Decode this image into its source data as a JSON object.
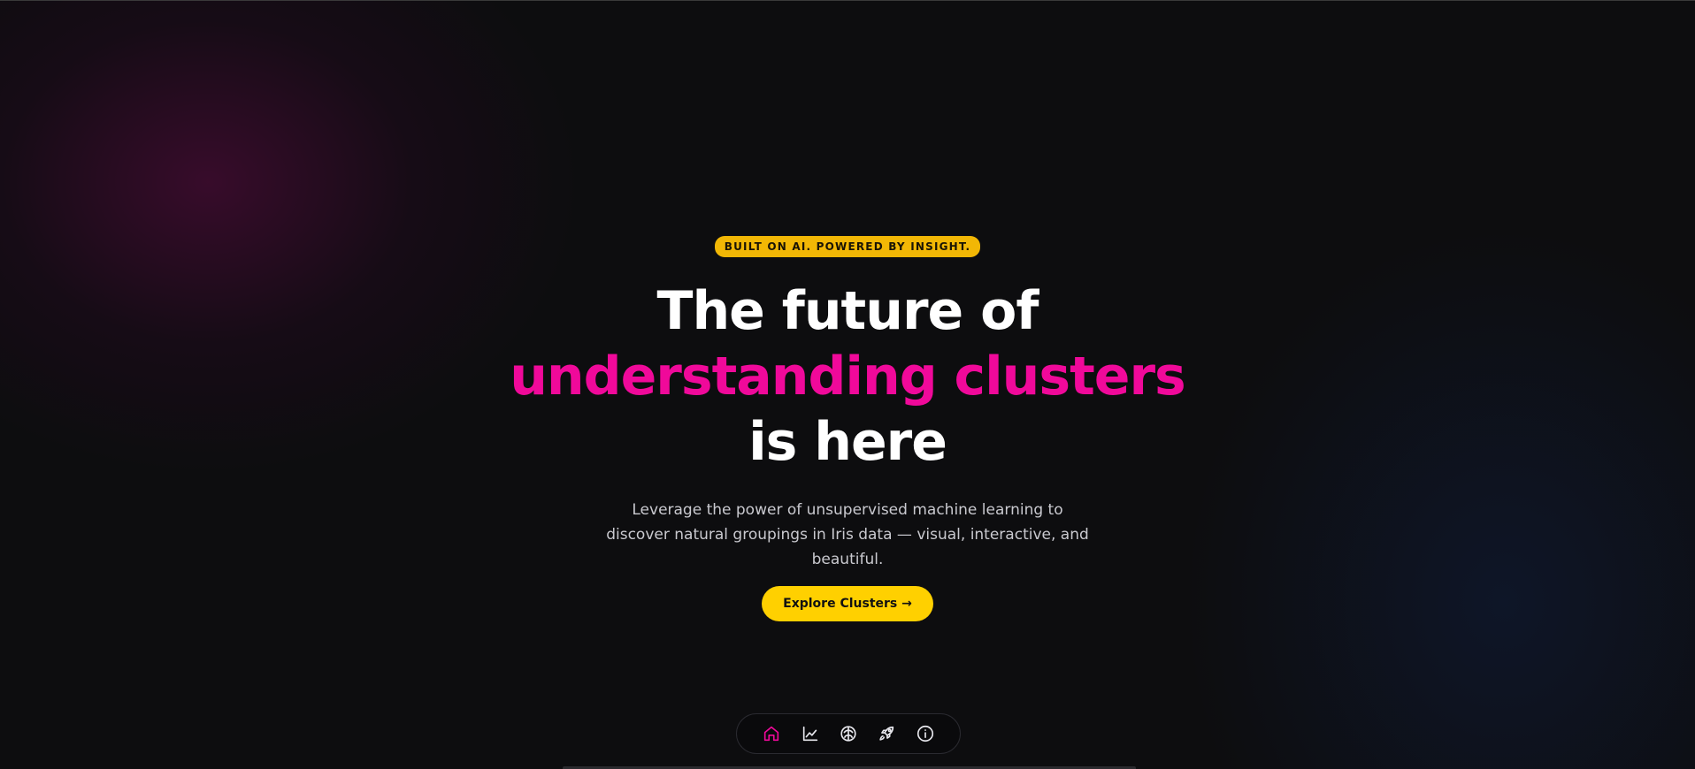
{
  "hero": {
    "badge": "BUILT ON AI. POWERED BY INSIGHT.",
    "headline_line1": "The future of",
    "headline_accent": "understanding clusters",
    "headline_line3": "is here",
    "subtext": "Leverage the power of unsupervised machine learning to discover natural groupings in Iris data — visual, interactive, and beautiful.",
    "cta_label": "Explore Clusters →"
  },
  "dock": {
    "items": [
      {
        "icon": "home-icon",
        "active": true
      },
      {
        "icon": "chart-line-icon",
        "active": false
      },
      {
        "icon": "brain-icon",
        "active": false
      },
      {
        "icon": "rocket-icon",
        "active": false
      },
      {
        "icon": "info-icon",
        "active": false
      }
    ]
  },
  "colors": {
    "accent_pink": "#f0099a",
    "accent_yellow": "#ffd000",
    "badge_yellow": "#f2b705",
    "background": "#0d0d0f"
  }
}
